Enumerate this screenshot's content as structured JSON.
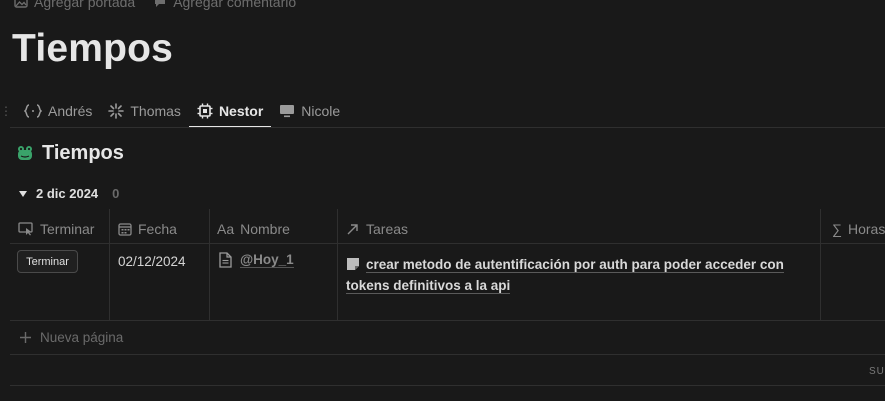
{
  "topbar": {
    "add_cover": "Agregar portada",
    "add_comment": "Agregar comentario"
  },
  "page": {
    "title": "Tiempos"
  },
  "tabs": [
    {
      "label": "Andrés",
      "icon": "code-braces-icon"
    },
    {
      "label": "Thomas",
      "icon": "sparkle-burst-icon"
    },
    {
      "label": "Nestor",
      "icon": "chip-icon",
      "active": true
    },
    {
      "label": "Nicole",
      "icon": "monitor-icon"
    }
  ],
  "database": {
    "title": "Tiempos",
    "icon": "frog-icon",
    "icon_color": "#3aa36a"
  },
  "group": {
    "label": "2 dic 2024",
    "count": "0"
  },
  "columns": {
    "terminar": "Terminar",
    "fecha": "Fecha",
    "nombre": "Nombre",
    "tareas": "Tareas",
    "horas": "Horas"
  },
  "column_icons": {
    "terminar": "cursor-click-icon",
    "fecha": "calendar-icon",
    "nombre": "text-aa-icon",
    "tareas": "arrow-northeast-icon",
    "horas": "sigma-icon"
  },
  "column_prefixes": {
    "nombre": "Aa",
    "horas": "∑"
  },
  "row": {
    "button": "Terminar",
    "fecha": "02/12/2024",
    "nombre": "@Hoy_1",
    "tarea": "crear metodo de autentificación por auth para poder acceder con tokens definitivos a la api"
  },
  "new_page": "Nueva página",
  "footer": {
    "sum_label": "SU"
  },
  "colors": {
    "background": "#191919",
    "text": "#d4d4d4",
    "muted": "#8a8a8a",
    "border": "#2f2f2f"
  }
}
